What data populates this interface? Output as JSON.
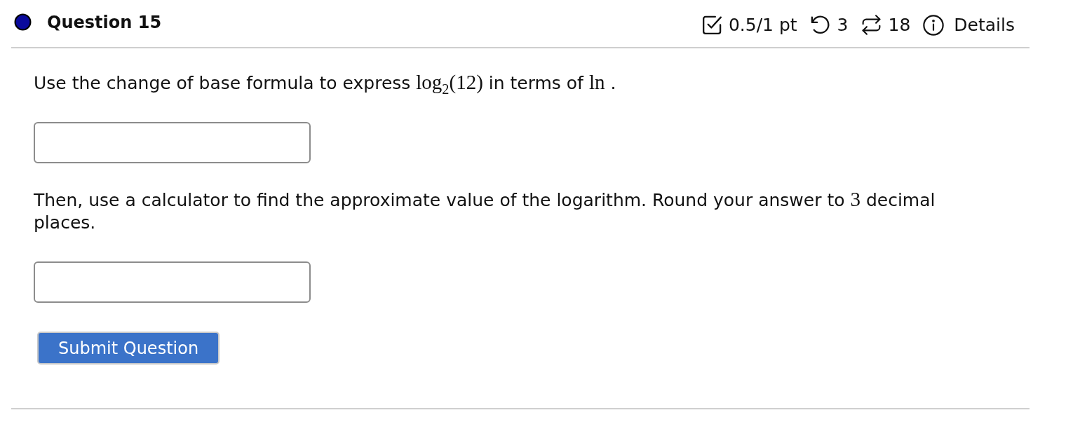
{
  "question": {
    "title": "Question 15",
    "points": "0.5/1 pt",
    "attempts": "3",
    "retries": "18",
    "details": "Details"
  },
  "parts": [
    {
      "kind": "prompt",
      "segments": [
        {
          "kind": "text",
          "text": "Use the change of base formula to express "
        },
        {
          "kind": "math",
          "text": "log$_{2}$(12)"
        },
        {
          "kind": "text",
          "text": " in terms of "
        },
        {
          "kind": "math",
          "text": "ln"
        },
        {
          "kind": "text",
          "text": " ."
        }
      ]
    },
    {
      "kind": "answer"
    },
    {
      "kind": "prompt",
      "segments": [
        {
          "kind": "text",
          "text": "Then, use a calculator to find the approximate value of the logarithm. Round your answer to "
        },
        {
          "kind": "math",
          "text": "3"
        },
        {
          "kind": "text",
          "text": " decimal places."
        }
      ]
    },
    {
      "kind": "answer"
    }
  ],
  "submit": "Submit Question"
}
